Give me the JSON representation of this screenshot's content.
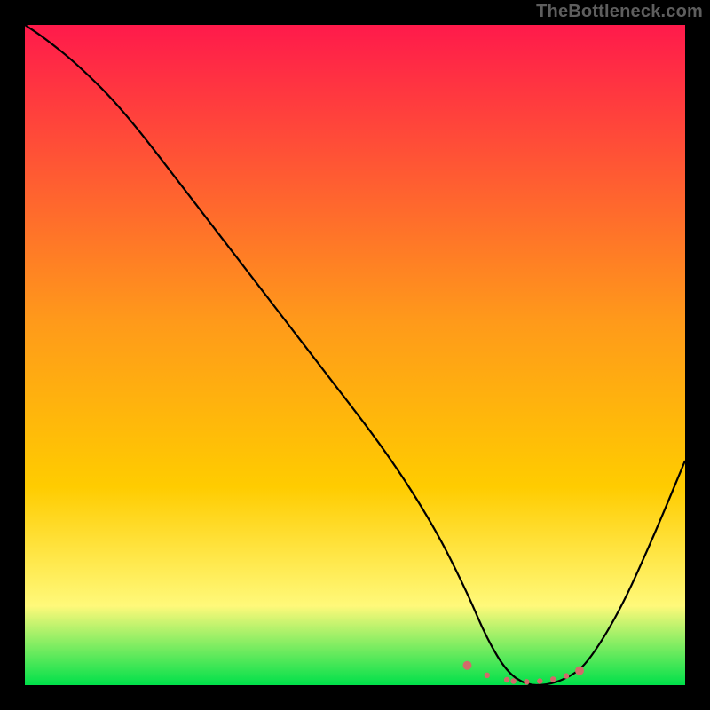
{
  "watermark": "TheBottleneck.com",
  "colors": {
    "background": "#000000",
    "gradient_top": "#ff1a4b",
    "gradient_mid": "#ffcc00",
    "gradient_low": "#fff97a",
    "gradient_bottom": "#00e04a",
    "curve": "#000000",
    "dots": "#d46a6a"
  },
  "chart_data": {
    "type": "line",
    "title": "",
    "xlabel": "",
    "ylabel": "",
    "xlim": [
      0,
      100
    ],
    "ylim": [
      0,
      100
    ],
    "series": [
      {
        "name": "bottleneck-curve",
        "x": [
          0,
          3,
          8,
          15,
          25,
          35,
          45,
          55,
          62,
          67,
          70,
          73,
          76,
          79,
          82,
          85,
          90,
          95,
          100
        ],
        "values": [
          100,
          98,
          94,
          87,
          74,
          61,
          48,
          35,
          24,
          14,
          7,
          2,
          0,
          0,
          1,
          3,
          11,
          22,
          34
        ]
      }
    ],
    "optimal_region": {
      "name": "optimal-dots",
      "x": [
        67,
        70,
        73,
        74,
        76,
        78,
        80,
        82,
        84
      ],
      "values": [
        3,
        1.5,
        0.8,
        0.6,
        0.5,
        0.6,
        0.9,
        1.4,
        2.2
      ]
    }
  }
}
